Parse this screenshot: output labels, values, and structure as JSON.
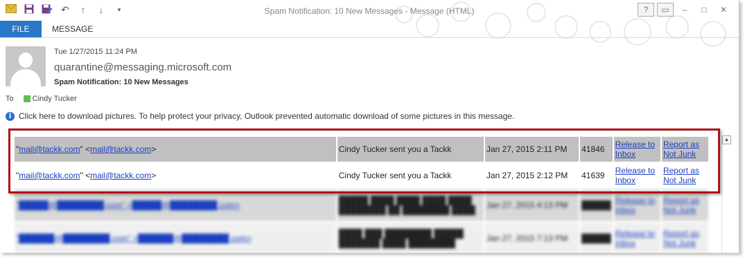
{
  "window": {
    "title": "Spam Notification: 10 New Messages - Message (HTML)",
    "qat_icons": [
      "mail-icon",
      "save-icon",
      "save-as-icon",
      "undo-icon",
      "up-arrow-icon",
      "down-arrow-icon",
      "customize-qat-icon"
    ],
    "controls": [
      "help-icon",
      "minimize-icon",
      "maximize-icon",
      "close-icon"
    ]
  },
  "ribbon": {
    "file_label": "FILE",
    "message_label": "MESSAGE"
  },
  "header": {
    "date": "Tue 1/27/2015 11:24 PM",
    "from": "quarantine@messaging.microsoft.com",
    "subject": "Spam Notification: 10 New Messages",
    "to_label": "To",
    "recipient": "Cindy Tucker"
  },
  "info_bar": {
    "text": "Click here to download pictures. To help protect your privacy, Outlook prevented automatic download of some pictures in this message."
  },
  "messages": [
    {
      "sender_email": "mail@tackk.com",
      "sender_display": "mail@tackk.com",
      "subject": "Cindy Tucker sent you a Tackk",
      "date": "Jan 27, 2015 2:11 PM",
      "size": "41846",
      "release": "Release to Inbox",
      "report": "Report as Not Junk"
    },
    {
      "sender_email": "mail@tackk.com",
      "sender_display": "mail@tackk.com",
      "subject": "Cindy Tucker sent you a Tackk",
      "date": "Jan 27, 2015 2:12 PM",
      "size": "41639",
      "release": "Release to Inbox",
      "report": "Report as Not Junk"
    },
    {
      "sender_email": "",
      "sender_display": "",
      "subject": "",
      "date": "Jan 27, 2015 4:13 PM",
      "size": "",
      "release": "Release to Inbox",
      "report": "Report as Not Junk"
    },
    {
      "sender_email": "",
      "sender_display": "",
      "subject": "",
      "date": "Jan 27, 2015 7:13 PM",
      "size": "",
      "release": "Release to Inbox",
      "report": "Report as Not Junk"
    }
  ],
  "colors": {
    "file_tab": "#2a78c5",
    "highlight_border": "#b00f16",
    "link": "#1a3fbf",
    "presence_green": "#5cc14c"
  }
}
